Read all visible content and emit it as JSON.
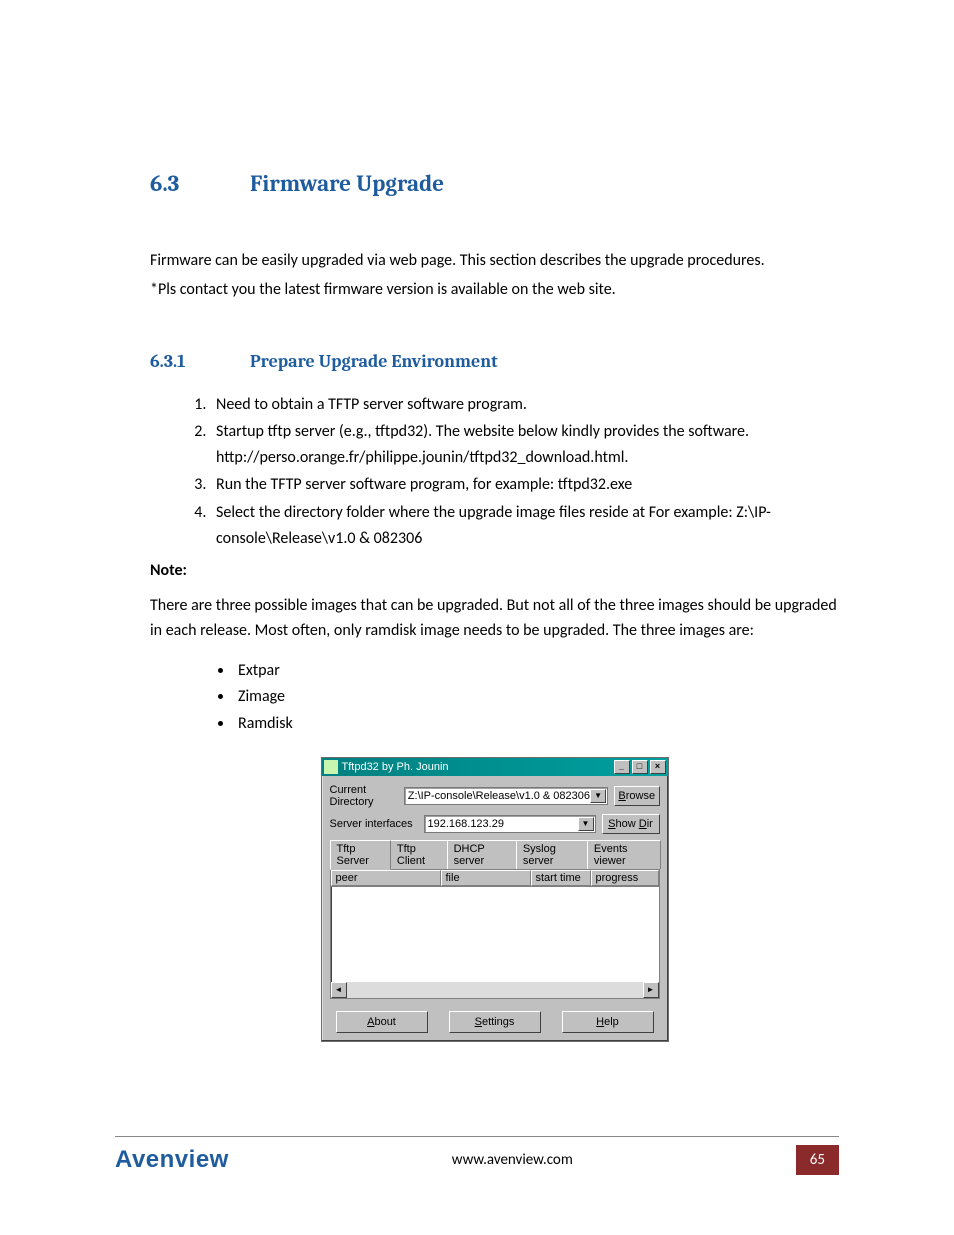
{
  "heading": {
    "number": "6.3",
    "title": "Firmware Upgrade"
  },
  "intro": {
    "p1": "Firmware can be easily upgraded via web page. This section describes the upgrade procedures.",
    "p2": "*Pls contact you the latest firmware version is available on the web site."
  },
  "subheading": {
    "number": "6.3.1",
    "title": "Prepare Upgrade Environment"
  },
  "steps": [
    "Need to obtain a TFTP server software program.",
    "Startup tftp server (e.g., tftpd32). The website below kindly provides the software. http://perso.orange.fr/philippe.jounin/tftpd32_download.html.",
    "Run the TFTP server software program, for example: tftpd32.exe",
    "Select the directory folder where the upgrade image files reside at For example: Z:\\IP-console\\Release\\v1.0 & 082306"
  ],
  "note_label": "Note:",
  "note_body": "There are three possible images that can be upgraded. But not all of the three images should be upgraded in each release. Most often, only ramdisk image needs to be upgraded. The three images are:",
  "images": [
    "Extpar",
    "Zimage",
    "Ramdisk"
  ],
  "app": {
    "title": "Tftpd32 by Ph. Jounin",
    "current_dir_label": "Current Directory",
    "current_dir_value": "Z:\\IP-console\\Release\\v1.0 & 082306",
    "server_if_label": "Server interfaces",
    "server_if_value": "192.168.123.29",
    "browse_label": "Browse",
    "showdir_label": "Show Dir",
    "tabs": [
      "Tftp Server",
      "Tftp Client",
      "DHCP server",
      "Syslog server",
      "Events viewer"
    ],
    "columns": [
      "peer",
      "file",
      "start time",
      "progress"
    ],
    "buttons": {
      "about": "About",
      "settings": "Settings",
      "help": "Help"
    }
  },
  "footer": {
    "brand": "Avenview",
    "url": "www.avenview.com",
    "page": "65"
  }
}
